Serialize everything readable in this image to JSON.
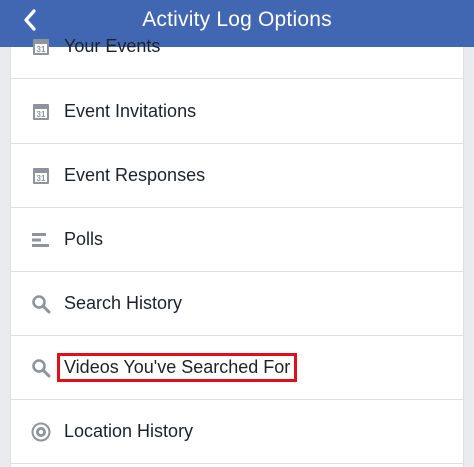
{
  "header": {
    "title": "Activity Log Options",
    "back_icon": "chevron-left-icon",
    "color": "#4267b2"
  },
  "items": [
    {
      "label": "Your Events",
      "icon": "calendar-icon"
    },
    {
      "label": "Event Invitations",
      "icon": "calendar-icon"
    },
    {
      "label": "Event Responses",
      "icon": "calendar-icon"
    },
    {
      "label": "Polls",
      "icon": "poll-icon"
    },
    {
      "label": "Search History",
      "icon": "search-icon"
    },
    {
      "label": "Videos You've Searched For",
      "icon": "search-icon",
      "highlighted": true,
      "highlight_color": "#e0101a"
    },
    {
      "label": "Location History",
      "icon": "location-icon"
    }
  ]
}
